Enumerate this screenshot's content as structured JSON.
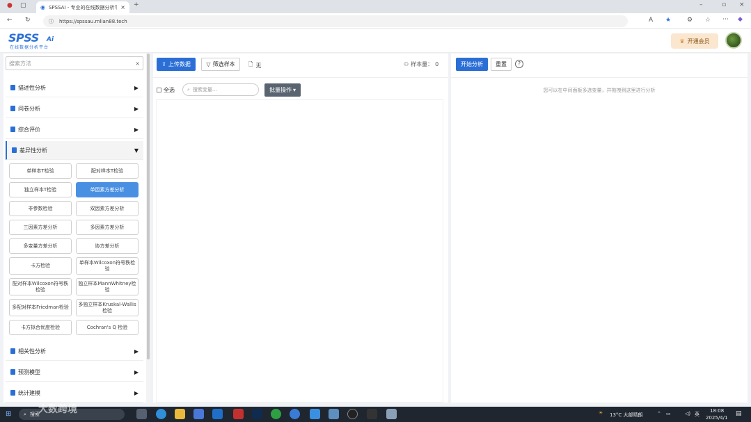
{
  "browser": {
    "tab_title": "SPSSAI - 专业的在线数据分析平台",
    "url": "https://spssau.rnlian88.tech",
    "new_tab": "+"
  },
  "header": {
    "logo_text": "SPSS",
    "logo_ai": "Ai",
    "logo_sub": "在线数据分析平台",
    "vip_label": "开通会员"
  },
  "left": {
    "search_placeholder": "搜索方法",
    "search_clear": "×",
    "categories_top": [
      {
        "label": "描述性分析"
      },
      {
        "label": "问卷分析"
      },
      {
        "label": "综合评价"
      },
      {
        "label": "差异性分析"
      }
    ],
    "methods": [
      [
        "单样本T检验",
        "配对样本T检验"
      ],
      [
        "独立样本T检验",
        "单因素方差分析"
      ],
      [
        "非参数检验",
        "双因素方差分析"
      ],
      [
        "三因素方差分析",
        "多因素方差分析"
      ],
      [
        "多变量方差分析",
        "协方差分析"
      ],
      [
        "卡方检验",
        "单样本Wilcoxon符号秩检验"
      ],
      [
        "配对样本Wilcoxon符号秩检验",
        "独立样本MannWhitney检验"
      ],
      [
        "多配对样本Friedman检验",
        "多独立样本Kruskal-Wallis检验"
      ],
      [
        "卡方拟合优度检验",
        "Cochran's Q 检验"
      ]
    ],
    "categories_bottom": [
      {
        "label": "相关性分析"
      },
      {
        "label": "预测模型"
      },
      {
        "label": "统计建模"
      }
    ]
  },
  "middle": {
    "upload_label": "上传数据",
    "filter_label": "筛选样本",
    "file_label": "无",
    "sample_label": "样本量：",
    "sample_count": "0",
    "select_all": "全选",
    "var_search_placeholder": "搜索变量...",
    "batch_label": "批量操作"
  },
  "right": {
    "start_label": "开始分析",
    "reset_label": "重置",
    "help_icon": "?",
    "hint": "您可以在中间面板多选变量，并拖拽到这里进行分析"
  },
  "taskbar": {
    "search_text": "搜索",
    "weather": "13°C 大部晴朗",
    "ime": "英",
    "time": "18:08",
    "date": "2025/4/1",
    "watermark": "大数跨境"
  }
}
